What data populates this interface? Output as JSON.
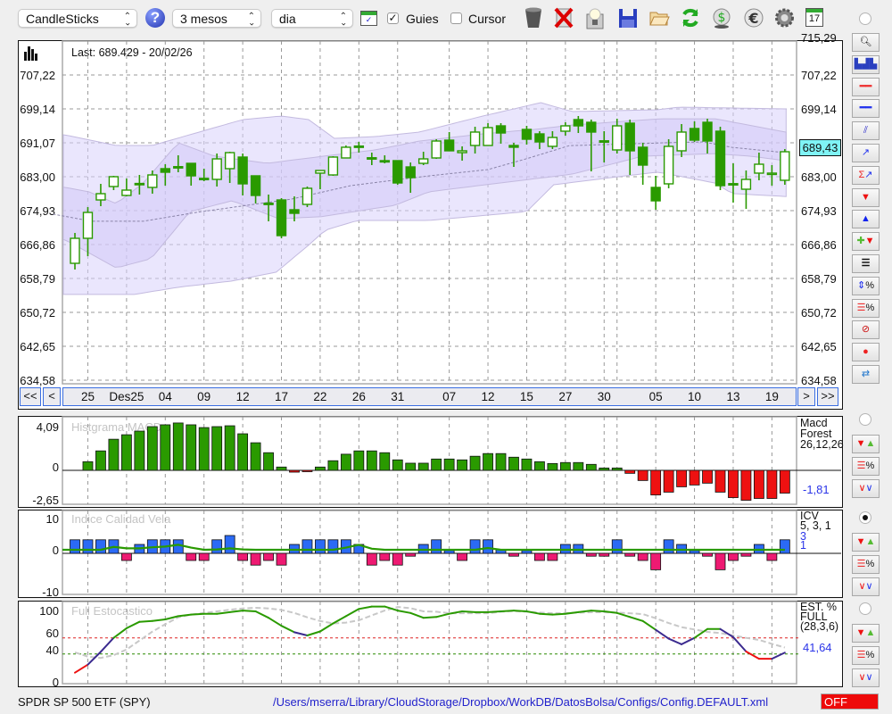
{
  "toolbar": {
    "chart_type": "CandleSticks",
    "period": "3 mesos",
    "interval": "dia",
    "guides_label": "Guies",
    "guides_checked": true,
    "cursor_label": "Cursor",
    "cursor_checked": false,
    "icons": [
      "help-icon",
      "chart-window-icon",
      "trash-icon",
      "delete-icon",
      "lightbulb-icon",
      "save-icon",
      "open-folder-icon",
      "refresh-icon",
      "dollar-refresh-icon",
      "euro-icon",
      "gear-icon",
      "calendar-icon"
    ],
    "calendar_day": "17"
  },
  "main_chart": {
    "last_label": "Last: 689.429 - 20/02/26",
    "y_labels": [
      "715,29",
      "707,22",
      "699,14",
      "691,07",
      "683,00",
      "674,93",
      "666,86",
      "658,79",
      "650,72",
      "642,65",
      "634,58"
    ],
    "y_range": [
      634.58,
      715.29
    ],
    "current_price": "689,43",
    "colors": {
      "candle": "#2a9a00",
      "band_outer": "#d9d2fb",
      "band_inner": "#cfc6f7",
      "price_box": "#7ff3f5"
    },
    "candles": [
      [
        662.4,
        669.63,
        660.92,
        668.35
      ],
      [
        668.35,
        675.78,
        664.1,
        674.51
      ],
      [
        677.48,
        681.31,
        676.0,
        678.97
      ],
      [
        680.67,
        683.22,
        679.82,
        683.01
      ],
      [
        678.55,
        682.58,
        678.33,
        679.82
      ],
      [
        681.4,
        683.43,
        678.76,
        681.31
      ],
      [
        680.46,
        684.49,
        678.97,
        683.43
      ],
      [
        684.92,
        685.98,
        680.88,
        684.07
      ],
      [
        685.4,
        688.1,
        684.07,
        685.34
      ],
      [
        686.19,
        686.19,
        680.88,
        683.22
      ],
      [
        682.62,
        684.92,
        681.94,
        682.58
      ],
      [
        682.37,
        688.53,
        680.67,
        687.25
      ],
      [
        684.92,
        688.95,
        681.52,
        688.74
      ],
      [
        687.68,
        688.53,
        678.55,
        681.31
      ],
      [
        683.22,
        683.22,
        676.63,
        678.55
      ],
      [
        676.7,
        678.76,
        672.39,
        676.63
      ],
      [
        677.48,
        677.91,
        668.35,
        668.99
      ],
      [
        675.15,
        678.33,
        672.39,
        674.3
      ],
      [
        676.42,
        680.67,
        675.78,
        680.25
      ],
      [
        683.86,
        684.49,
        680.03,
        684.49
      ],
      [
        683.43,
        687.89,
        683.22,
        687.68
      ],
      [
        687.47,
        690.44,
        687.47,
        690.02
      ],
      [
        690.3,
        691.29,
        688.74,
        690.23
      ],
      [
        687.52,
        688.74,
        685.77,
        687.47
      ],
      [
        686.83,
        688.1,
        686.19,
        686.62
      ],
      [
        686.83,
        686.83,
        681.09,
        681.52
      ],
      [
        685.34,
        686.4,
        679.18,
        682.79
      ],
      [
        686.19,
        688.95,
        685.77,
        687.25
      ],
      [
        687.47,
        691.93,
        687.25,
        691.5
      ],
      [
        691.71,
        693.63,
        689.17,
        689.17
      ],
      [
        688.74,
        690.23,
        686.83,
        689.17
      ],
      [
        690.44,
        694.9,
        688.53,
        693.63
      ],
      [
        690.44,
        695.75,
        690.44,
        694.69
      ],
      [
        695.11,
        695.75,
        690.87,
        693.41
      ],
      [
        690.44,
        691.08,
        685.34,
        690.02
      ],
      [
        694.26,
        695.11,
        690.65,
        691.93
      ],
      [
        693.2,
        693.84,
        689.59,
        691.29
      ],
      [
        690.23,
        693.84,
        689.59,
        692.35
      ],
      [
        693.84,
        695.96,
        692.78,
        695.11
      ],
      [
        696.6,
        697.45,
        693.41,
        695.11
      ],
      [
        695.96,
        696.6,
        684.28,
        693.63
      ],
      [
        691.55,
        693.84,
        686.4,
        691.5
      ],
      [
        689.38,
        696.81,
        688.53,
        695.11
      ],
      [
        695.75,
        696.6,
        683.43,
        689.17
      ],
      [
        690.02,
        691.08,
        681.09,
        685.77
      ],
      [
        680.46,
        683.22,
        675.15,
        677.27
      ],
      [
        681.31,
        691.93,
        680.25,
        690.23
      ],
      [
        689.17,
        695.54,
        687.68,
        693.63
      ],
      [
        694.48,
        696.18,
        691.29,
        691.71
      ],
      [
        695.96,
        696.81,
        688.53,
        691.5
      ],
      [
        693.84,
        694.9,
        679.82,
        680.88
      ],
      [
        681.36,
        686.19,
        676.85,
        681.31
      ],
      [
        680.03,
        684.49,
        675.36,
        682.37
      ],
      [
        683.86,
        688.74,
        682.16,
        685.98
      ],
      [
        683.64,
        685.77,
        680.88,
        683.86
      ],
      [
        682.16,
        689.59,
        681.09,
        688.95
      ]
    ],
    "bands": {
      "outer_upper": [
        [
          -0.8,
          692.99
        ],
        [
          3.2,
          690.44
        ],
        [
          6.0,
          690.44
        ],
        [
          10.1,
          694.05
        ],
        [
          13.0,
          696.6
        ],
        [
          16.0,
          697.45
        ],
        [
          18.1,
          696.6
        ],
        [
          20.1,
          692.14
        ],
        [
          23.3,
          692.56
        ],
        [
          26.7,
          693.63
        ],
        [
          31.6,
          697.45
        ],
        [
          36.1,
          700.64
        ],
        [
          38.5,
          698.51
        ],
        [
          45.1,
          698.94
        ],
        [
          46.8,
          699.57
        ],
        [
          55.1,
          699.15
        ]
      ],
      "outer_lower": [
        [
          -0.8,
          655.0
        ],
        [
          4.6,
          655.0
        ],
        [
          8.0,
          656.7
        ],
        [
          12.2,
          658.2
        ],
        [
          15.6,
          660.3
        ],
        [
          18.1,
          666.7
        ],
        [
          19.4,
          670.3
        ],
        [
          21.9,
          672.6
        ],
        [
          27.4,
          672.6
        ],
        [
          35.0,
          674.7
        ],
        [
          37.1,
          681.1
        ],
        [
          42.6,
          683.2
        ],
        [
          45.2,
          684.1
        ],
        [
          49.6,
          681.5
        ],
        [
          50.9,
          679.0
        ],
        [
          55.1,
          678.3
        ]
      ],
      "inner_upper": [
        [
          -0.8,
          680.5
        ],
        [
          1.1,
          679.4
        ],
        [
          3.2,
          676.6
        ],
        [
          5.3,
          681.5
        ],
        [
          8.0,
          691.1
        ],
        [
          10.8,
          687.9
        ],
        [
          14.9,
          686.2
        ],
        [
          17.7,
          687.3
        ],
        [
          23.3,
          689.4
        ],
        [
          26.7,
          691.5
        ],
        [
          31.6,
          693.2
        ],
        [
          35.7,
          694.3
        ],
        [
          38.5,
          695.3
        ],
        [
          45.4,
          696.8
        ],
        [
          49.6,
          696.8
        ],
        [
          55.1,
          693.6
        ]
      ],
      "inner_lower": [
        [
          -0.8,
          668.1
        ],
        [
          3.2,
          661.3
        ],
        [
          5.9,
          663.5
        ],
        [
          8.9,
          674.7
        ],
        [
          12.2,
          677.3
        ],
        [
          15.8,
          673.0
        ],
        [
          19.1,
          673.5
        ],
        [
          24.8,
          676.2
        ],
        [
          27.4,
          679.4
        ],
        [
          32.9,
          681.5
        ],
        [
          38.5,
          683.6
        ],
        [
          44.0,
          687.9
        ],
        [
          49.6,
          688.5
        ],
        [
          52.3,
          687.9
        ],
        [
          55.1,
          686.8
        ]
      ],
      "moving_average": [
        [
          -1.7,
          674.1
        ],
        [
          1.3,
          672.4
        ],
        [
          5.3,
          672.4
        ],
        [
          9.4,
          674.5
        ],
        [
          16.8,
          677.7
        ],
        [
          21.4,
          680.9
        ],
        [
          27.4,
          683.2
        ],
        [
          32.0,
          684.7
        ],
        [
          35.0,
          687.3
        ],
        [
          38.3,
          690.4
        ],
        [
          45.9,
          691.1
        ],
        [
          48.7,
          691.3
        ],
        [
          50.9,
          690.0
        ],
        [
          55.1,
          688.7
        ]
      ]
    },
    "x_ticks": [
      {
        "label": "25",
        "candle": 1
      },
      {
        "label": "Des25",
        "candle": 4
      },
      {
        "label": "04",
        "candle": 7
      },
      {
        "label": "09",
        "candle": 10
      },
      {
        "label": "12",
        "candle": 13
      },
      {
        "label": "17",
        "candle": 16
      },
      {
        "label": "22",
        "candle": 19
      },
      {
        "label": "26",
        "candle": 22
      },
      {
        "label": "31",
        "candle": 25
      },
      {
        "label": "07",
        "candle": 29
      },
      {
        "label": "12",
        "candle": 32
      },
      {
        "label": "15",
        "candle": 35
      },
      {
        "label": "27",
        "candle": 38
      },
      {
        "label": "30",
        "candle": 41
      },
      {
        "label": "05",
        "candle": 45
      },
      {
        "label": "10",
        "candle": 48
      },
      {
        "label": "13",
        "candle": 51
      },
      {
        "label": "19",
        "candle": 54
      }
    ],
    "extra_gridline_candle": 42,
    "nav": {
      "first": "<<",
      "prev": "<",
      "next": ">",
      "last": ">>"
    }
  },
  "macd": {
    "title": "Histgrama MACD",
    "name_line1": "Macd",
    "name_line2": "Forest",
    "params": "26,12,26",
    "value": "-1,81",
    "y_labels": [
      "4,09",
      "0",
      "-2,65"
    ],
    "range": [
      -2.65,
      4.09
    ],
    "colors": {
      "positive": "#2a9a00",
      "negative": "#ee1111"
    },
    "values": [
      null,
      0.81,
      1.82,
      2.91,
      3.33,
      3.67,
      4.09,
      4.26,
      4.43,
      4.26,
      4.0,
      4.09,
      4.17,
      3.42,
      2.58,
      1.65,
      0.31,
      -0.17,
      -0.05,
      0.31,
      0.9,
      1.51,
      1.82,
      1.82,
      1.65,
      0.98,
      0.67,
      0.67,
      1.06,
      1.06,
      0.98,
      1.32,
      1.57,
      1.57,
      1.23,
      1.06,
      0.81,
      0.64,
      0.73,
      0.73,
      0.56,
      0.22,
      0.22,
      -0.28,
      -0.95,
      -2.3,
      -2.04,
      -1.54,
      -1.37,
      -1.2,
      -2.04,
      -2.55,
      -2.8,
      -2.63,
      -2.63,
      -2.13
    ]
  },
  "icv": {
    "title": "Indice Calidad Vela",
    "name": "ICV",
    "params": "5, 3, 1",
    "value1": "3",
    "value2": "1",
    "y_labels": [
      "10",
      "0",
      "-10"
    ],
    "range": [
      -10,
      10
    ],
    "colors": {
      "positive": "#2b6af5",
      "negative": "#ee1a72",
      "line": "#2a9a00"
    },
    "values": [
      3.8,
      3.8,
      3.8,
      3.8,
      -2,
      2.5,
      3.8,
      3.8,
      3.8,
      -2,
      -2,
      3.8,
      5,
      -2,
      -3.3,
      -2,
      -3.3,
      2.5,
      3.8,
      3.8,
      3.8,
      3.8,
      2.5,
      -3.3,
      -2,
      -3.3,
      -0.8,
      2.5,
      3.8,
      0.8,
      -2,
      3.8,
      3.8,
      1,
      -0.8,
      0.8,
      -2,
      -2,
      2.5,
      2.5,
      -0.8,
      -0.8,
      3.8,
      -0.8,
      -2,
      -4.6,
      3.8,
      2.5,
      0.8,
      -0.8,
      -4.6,
      -2,
      -0.8,
      2.5,
      -2,
      3.8
    ],
    "line": [
      1,
      1,
      1,
      1.8,
      1.4,
      1.4,
      1.7,
      1.9,
      2.4,
      1.6,
      1.0,
      1.1,
      1.4,
      1.1,
      1,
      1,
      1,
      1,
      1,
      1,
      1,
      1.6,
      2.4,
      1.3,
      1,
      1,
      1,
      1,
      1,
      1,
      1,
      1,
      1.5,
      1,
      1,
      1,
      1,
      1,
      1,
      1,
      1,
      1,
      1,
      1,
      1,
      1,
      1,
      1,
      1,
      1,
      1,
      1,
      1,
      1,
      1,
      1
    ]
  },
  "stochastic": {
    "title": "Full Estocastico",
    "name_line1": "EST. %",
    "name_line2": "FULL",
    "params": "(28,3,6)",
    "value": "41,64",
    "y_labels": [
      "100",
      "60",
      "40",
      "0"
    ],
    "range": [
      0,
      100
    ],
    "levels": [
      60,
      40
    ],
    "colors": {
      "up": "#2a9a00",
      "mid": "#3b2a8f",
      "low": "#ee1111",
      "signal": "#c8c8c8",
      "level_high": "#dd2222",
      "level_low": "#2a8a00"
    },
    "k": [
      16.7,
      26.7,
      42.6,
      60,
      72,
      80,
      81,
      83,
      87,
      89,
      90,
      90,
      92,
      94,
      93,
      85,
      75,
      67,
      63,
      68,
      78,
      87,
      96,
      99,
      99,
      94,
      91,
      85,
      86,
      90,
      93,
      92,
      92,
      93,
      94,
      93,
      90,
      89,
      90,
      92,
      94,
      93,
      91,
      86,
      81,
      70,
      59,
      52,
      60,
      71,
      71,
      61,
      43,
      34,
      34,
      41.6
    ],
    "d": [
      42,
      36.7,
      35,
      38.5,
      45.6,
      56.7,
      67.8,
      77,
      85.6,
      89,
      91,
      93,
      95,
      96.7,
      97.4,
      96.7,
      94.8,
      91,
      85.6,
      81,
      78,
      79,
      81.9,
      88,
      94,
      98.5,
      97,
      93,
      92.6,
      90.7,
      90.7,
      90.7,
      90.7,
      92.6,
      93.3,
      92.6,
      91.5,
      90.7,
      90.7,
      91.5,
      91.9,
      91.9,
      91.5,
      90.7,
      89.6,
      84.4,
      78.5,
      73.3,
      70.4,
      67.4,
      66,
      63,
      60,
      57.4,
      52.6,
      48
    ]
  },
  "status": {
    "instrument": "SPDR SP 500 ETF (SPY)",
    "config_path": "/Users/mserra/Library/CloudStorage/Dropbox/WorkDB/DatosBolsa/Configs/Config.DEFAULT.xml",
    "off_label": "OFF"
  },
  "sidebar_tools": [
    "zoom-icon",
    "volume-chart-icon",
    "red-line-icon",
    "blue-line-icon",
    "channel-icon",
    "trendline-icon",
    "sigma-trendline-icon",
    "arrow-down-icon",
    "arrow-up-icon",
    "add-alert-icon",
    "dashed-lines-icon",
    "range-percent-icon",
    "lines-percent-icon",
    "forbidden-icon",
    "record-icon",
    "swap-icon"
  ]
}
